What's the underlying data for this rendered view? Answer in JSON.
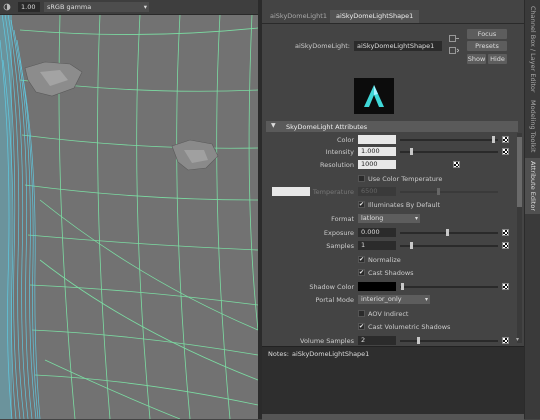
{
  "viewport": {
    "field_value": "1.00",
    "colorspace": "sRGB gamma"
  },
  "attribute_editor": {
    "tabs": [
      {
        "label": "aiSkyDomeLight1"
      },
      {
        "label": "aiSkyDomeLightShape1"
      }
    ],
    "node_label": "aiSkyDomeLight:",
    "node_name": "aiSkyDomeLightShape1",
    "buttons": {
      "focus": "Focus",
      "presets": "Presets",
      "show": "Show",
      "hide": "Hide"
    },
    "logo_letter": "A",
    "section_title": "SkyDomeLight Attributes",
    "attrs": {
      "color": {
        "label": "Color"
      },
      "intensity": {
        "label": "Intensity",
        "value": "1.000"
      },
      "resolution": {
        "label": "Resolution",
        "value": "1000"
      },
      "use_color_temperature": {
        "label": "Use Color Temperature",
        "checked": false
      },
      "temperature": {
        "label": "Temperature",
        "value": "6500"
      },
      "illuminates_by_default": {
        "label": "Illuminates By Default",
        "checked": true
      },
      "format": {
        "label": "Format",
        "value": "latlong"
      },
      "exposure": {
        "label": "Exposure",
        "value": "0.000"
      },
      "samples": {
        "label": "Samples",
        "value": "1"
      },
      "normalize": {
        "label": "Normalize",
        "checked": true
      },
      "cast_shadows": {
        "label": "Cast Shadows",
        "checked": true
      },
      "shadow_color": {
        "label": "Shadow Color"
      },
      "portal_mode": {
        "label": "Portal Mode",
        "value": "interior_only"
      },
      "aov_indirect": {
        "label": "AOV Indirect",
        "checked": false
      },
      "cast_volumetric_shadows": {
        "label": "Cast Volumetric Shadows",
        "checked": true
      },
      "volume_samples": {
        "label": "Volume Samples",
        "value": "2"
      }
    },
    "notes_label": "Notes:",
    "notes_node": "aiSkyDomeLightShape1"
  },
  "side_tabs": {
    "channel_box": "Channel Box / Layer Editor",
    "modeling_toolkit": "Modeling Toolkit",
    "attribute_editor": "Attribute Editor"
  },
  "colors": {
    "grid_line": "#7de8a8",
    "fur": "#5fd0ea",
    "logo_bg": "#0c0c0c",
    "logo_fg": "#3fd7d7"
  }
}
